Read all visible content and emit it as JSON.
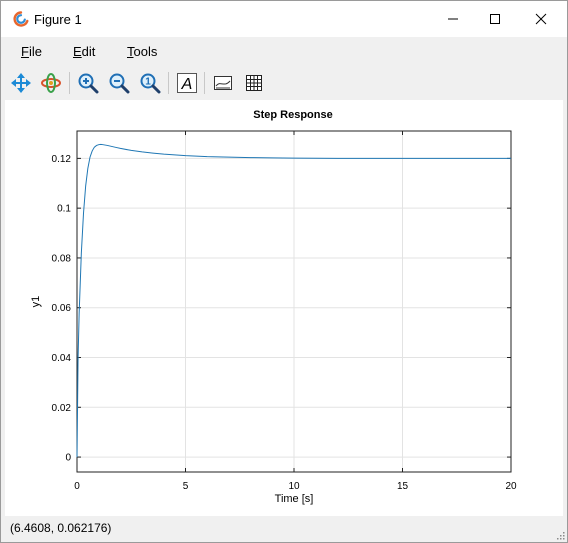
{
  "window": {
    "title": "Figure 1",
    "controls": {
      "minimize": "minimize",
      "maximize": "maximize",
      "close": "close"
    }
  },
  "menu": {
    "items": [
      {
        "label": "File",
        "mnemonic": "F",
        "rest": "ile"
      },
      {
        "label": "Edit",
        "mnemonic": "E",
        "rest": "dit"
      },
      {
        "label": "Tools",
        "mnemonic": "T",
        "rest": "ools"
      }
    ]
  },
  "toolbar": {
    "buttons": [
      {
        "name": "pan",
        "icon": "pan-arrows-icon"
      },
      {
        "name": "rotate-3d",
        "icon": "rotate-3d-icon"
      },
      {
        "name": "zoom-in",
        "icon": "zoom-in-icon"
      },
      {
        "name": "zoom-out",
        "icon": "zoom-out-icon"
      },
      {
        "name": "zoom-reset",
        "icon": "zoom-reset-icon"
      },
      {
        "name": "insert-text",
        "icon": "text-a-icon"
      },
      {
        "name": "legend",
        "icon": "legend-icon"
      },
      {
        "name": "grid",
        "icon": "grid-icon"
      }
    ],
    "text_button_glyph": "A",
    "zoom_reset_glyph": "1"
  },
  "status": {
    "text": "(6.4608, 0.062176)"
  },
  "colors": {
    "line": "#1f77b4",
    "grid": "#e3e3e3",
    "axis": "#000000"
  },
  "chart_data": {
    "type": "line",
    "title": "Step Response",
    "xlabel": "Time [s]",
    "ylabel": "y1",
    "xlim": [
      0,
      20
    ],
    "ylim": [
      -0.006,
      0.131
    ],
    "xticks": [
      0,
      5,
      10,
      15,
      20
    ],
    "xtick_labels": [
      "0",
      "5",
      "10",
      "15",
      "20"
    ],
    "yticks": [
      0,
      0.02,
      0.04,
      0.06,
      0.08,
      0.1,
      0.12
    ],
    "ytick_labels": [
      "0",
      "0.02",
      "0.04",
      "0.06",
      "0.08",
      "0.1",
      "0.12"
    ],
    "grid": true,
    "series": [
      {
        "x": [
          0,
          0.05,
          0.1,
          0.2,
          0.3,
          0.4,
          0.5,
          0.6,
          0.7,
          0.8,
          0.9,
          1.0,
          1.1,
          1.2,
          1.4,
          1.6,
          1.8,
          2.0,
          2.5,
          3.0,
          3.5,
          4.0,
          5.0,
          6.0,
          7.0,
          8.0,
          9.0,
          10.0,
          12.0,
          14.0,
          16.0,
          18.0,
          20.0
        ],
        "y": [
          0,
          0.04,
          0.058,
          0.082,
          0.098,
          0.109,
          0.116,
          0.1205,
          0.123,
          0.1245,
          0.1252,
          0.1255,
          0.1256,
          0.1255,
          0.1252,
          0.1248,
          0.1244,
          0.124,
          0.1232,
          0.1226,
          0.1221,
          0.1217,
          0.1211,
          0.1207,
          0.1205,
          0.1203,
          0.1202,
          0.1201,
          0.12,
          0.12,
          0.12,
          0.12,
          0.12
        ]
      }
    ]
  }
}
